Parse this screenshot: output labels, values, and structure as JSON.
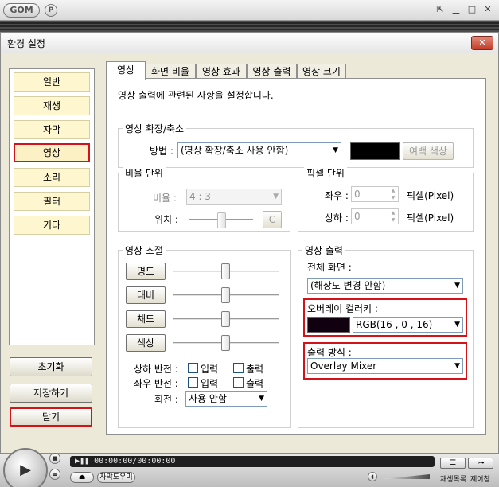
{
  "app": {
    "logo_text": "GOM",
    "p_badge": "P",
    "window_buttons": {
      "restore": "⇱",
      "minimize": "▁",
      "maximize": "□",
      "close": "✕"
    }
  },
  "dialog": {
    "title": "환경 설정",
    "close_glyph": "✕",
    "categories": [
      {
        "label": "일반",
        "selected": false
      },
      {
        "label": "재생",
        "selected": false
      },
      {
        "label": "자막",
        "selected": false
      },
      {
        "label": "영상",
        "selected": true
      },
      {
        "label": "소리",
        "selected": false
      },
      {
        "label": "필터",
        "selected": false
      },
      {
        "label": "기타",
        "selected": false
      }
    ],
    "buttons": {
      "reset": "초기화",
      "save": "저장하기",
      "close": "닫기"
    },
    "tabs": [
      {
        "label": "영상",
        "active": true
      },
      {
        "label": "화면 비율",
        "active": false
      },
      {
        "label": "영상 효과",
        "active": false
      },
      {
        "label": "영상 출력",
        "active": false
      },
      {
        "label": "영상 크기",
        "active": false
      }
    ],
    "panel": {
      "description": "영상 출력에 관련된 사항을 설정합니다.",
      "scale": {
        "group_title": "영상 확장/축소",
        "method_label": "방법 :",
        "method_value": "(영상 확장/축소 사용 안함)",
        "margin_color_button": "여백 색상",
        "margin_color": "#000000"
      },
      "ratio": {
        "group_title": "비율 단위",
        "ratio_label": "비율 :",
        "ratio_value": "4 : 3",
        "position_label": "위치 :",
        "center_button": "C"
      },
      "pixel": {
        "group_title": "픽셀 단위",
        "lr_label": "좌우 :",
        "lr_value": "0",
        "lr_unit": "픽셀(Pixel)",
        "ud_label": "상하 :",
        "ud_value": "0",
        "ud_unit": "픽셀(Pixel)"
      },
      "adjust": {
        "group_title": "영상 조절",
        "sliders": [
          {
            "label": "명도",
            "level": 0.5
          },
          {
            "label": "대비",
            "level": 0.5
          },
          {
            "label": "채도",
            "level": 0.5
          },
          {
            "label": "색상",
            "level": 0.5
          }
        ],
        "flip_v_label": "상하 반전 :",
        "flip_h_label": "좌우 반전 :",
        "input_label": "입력",
        "output_label": "출력",
        "rotate_label": "회전 :",
        "rotate_value": "사용 안함"
      },
      "output": {
        "group_title": "영상 출력",
        "fullscreen_label": "전체 화면 :",
        "fullscreen_value": "(해상도 변경 안함)",
        "overlay_label": "오버레이 컬러키 :",
        "overlay_value": "RGB(16 , 0 , 16)",
        "overlay_color": "#100010",
        "mode_label": "출력 방식 :",
        "mode_value": "Overlay Mixer"
      }
    }
  },
  "player": {
    "time_display": "▶❚❚ 00:00:00/00:00:00",
    "subtitle_button": "자막도우미",
    "eject_glyph": "⏏",
    "playlist_label": "재생목록",
    "control_label": "제어창",
    "play_glyph": "▶"
  }
}
